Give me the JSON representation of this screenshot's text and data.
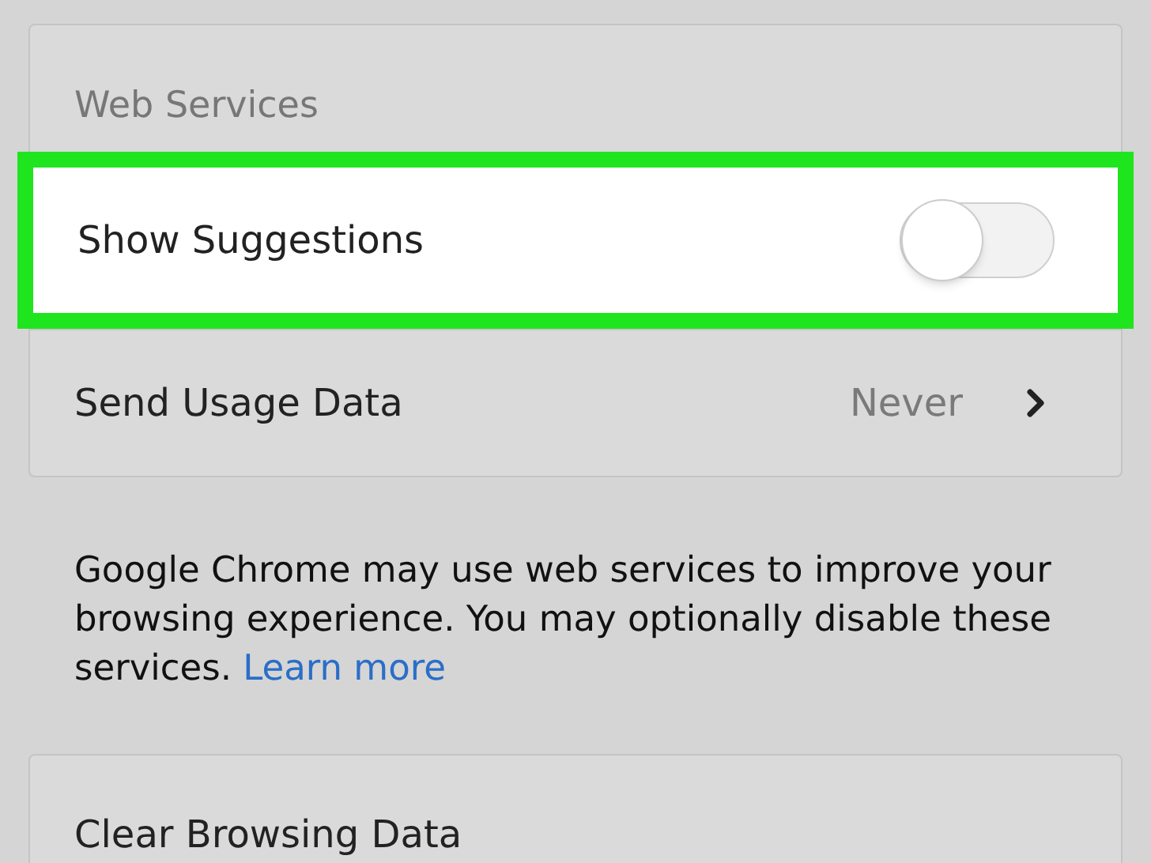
{
  "section_header": "Web Services",
  "rows": [
    {
      "kind": "toggle",
      "label": "Show Suggestions",
      "on": false,
      "highlighted": true
    },
    {
      "kind": "link",
      "label": "Send Usage Data",
      "value": "Never",
      "highlighted": false
    }
  ],
  "description": {
    "text": "Google Chrome may use web services to improve your browsing experience. You may optionally disable these services.",
    "link": "Learn more"
  },
  "second_card": {
    "rows": [
      {
        "label": "Clear Browsing Data"
      }
    ]
  }
}
